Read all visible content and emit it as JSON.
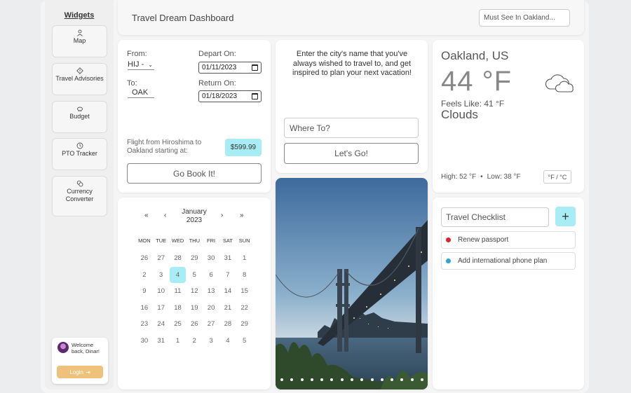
{
  "sidebar": {
    "title": "Widgets",
    "items": [
      {
        "label": "Map",
        "icon": "person-icon"
      },
      {
        "label": "Travel Advisories",
        "icon": "diamond-alert-icon"
      },
      {
        "label": "Budget",
        "icon": "piggy-bank-icon"
      },
      {
        "label": "PTO Tracker",
        "icon": "clock-icon"
      },
      {
        "label": "Currency Converter",
        "icon": "coins-icon"
      }
    ],
    "welcome": "Welcome back, Dinar!",
    "login_label": "Login"
  },
  "header": {
    "title": "Travel Dream Dashboard",
    "search_placeholder": "Must See In Oakland..."
  },
  "flight": {
    "from_label": "From:",
    "from_value": "HIJ -",
    "to_label": "To:",
    "to_value": "OAK",
    "depart_label": "Depart On:",
    "depart_value": "01/11/2023",
    "return_label": "Return On:",
    "return_value": "01/18/2023",
    "description": "Flight from Hiroshima to Oakland starting at:",
    "price": "$599.99",
    "book_label": "Go Book It!"
  },
  "city": {
    "prompt": "Enter the city's name that you've always wished to travel to, and get inspired to plan your next vacation!",
    "placeholder": "Where To?",
    "button_label": "Let's Go!"
  },
  "weather": {
    "city": "Oakland, US",
    "temp": "44 °F",
    "feels_like": "Feels Like: 41 °F",
    "condition": "Clouds",
    "high": "High: 52 °F",
    "separator": "•",
    "low": "Low: 38 °F",
    "unit_toggle": "°F / °C"
  },
  "calendar": {
    "prev_year": "«",
    "prev_month": "‹",
    "next_month": "›",
    "next_year": "»",
    "month": "January",
    "year": "2023",
    "weekdays": [
      "MON",
      "TUE",
      "WED",
      "THU",
      "FRI",
      "SAT",
      "SUN"
    ],
    "days": [
      "26",
      "27",
      "28",
      "29",
      "30",
      "31",
      "1",
      "2",
      "3",
      "4",
      "5",
      "6",
      "7",
      "8",
      "9",
      "10",
      "11",
      "12",
      "13",
      "14",
      "15",
      "16",
      "17",
      "18",
      "19",
      "20",
      "21",
      "22",
      "23",
      "24",
      "25",
      "26",
      "27",
      "28",
      "29",
      "30",
      "31",
      "1",
      "2",
      "3",
      "4",
      "5"
    ],
    "selected_index": 9
  },
  "photo": {
    "dots_count": 15
  },
  "checklist": {
    "placeholder": "Travel Checklist",
    "add_label": "+",
    "items": [
      {
        "label": "Renew passport",
        "color": "#e0202a"
      },
      {
        "label": "Add international phone plan",
        "color": "#2aa8c9"
      }
    ]
  }
}
